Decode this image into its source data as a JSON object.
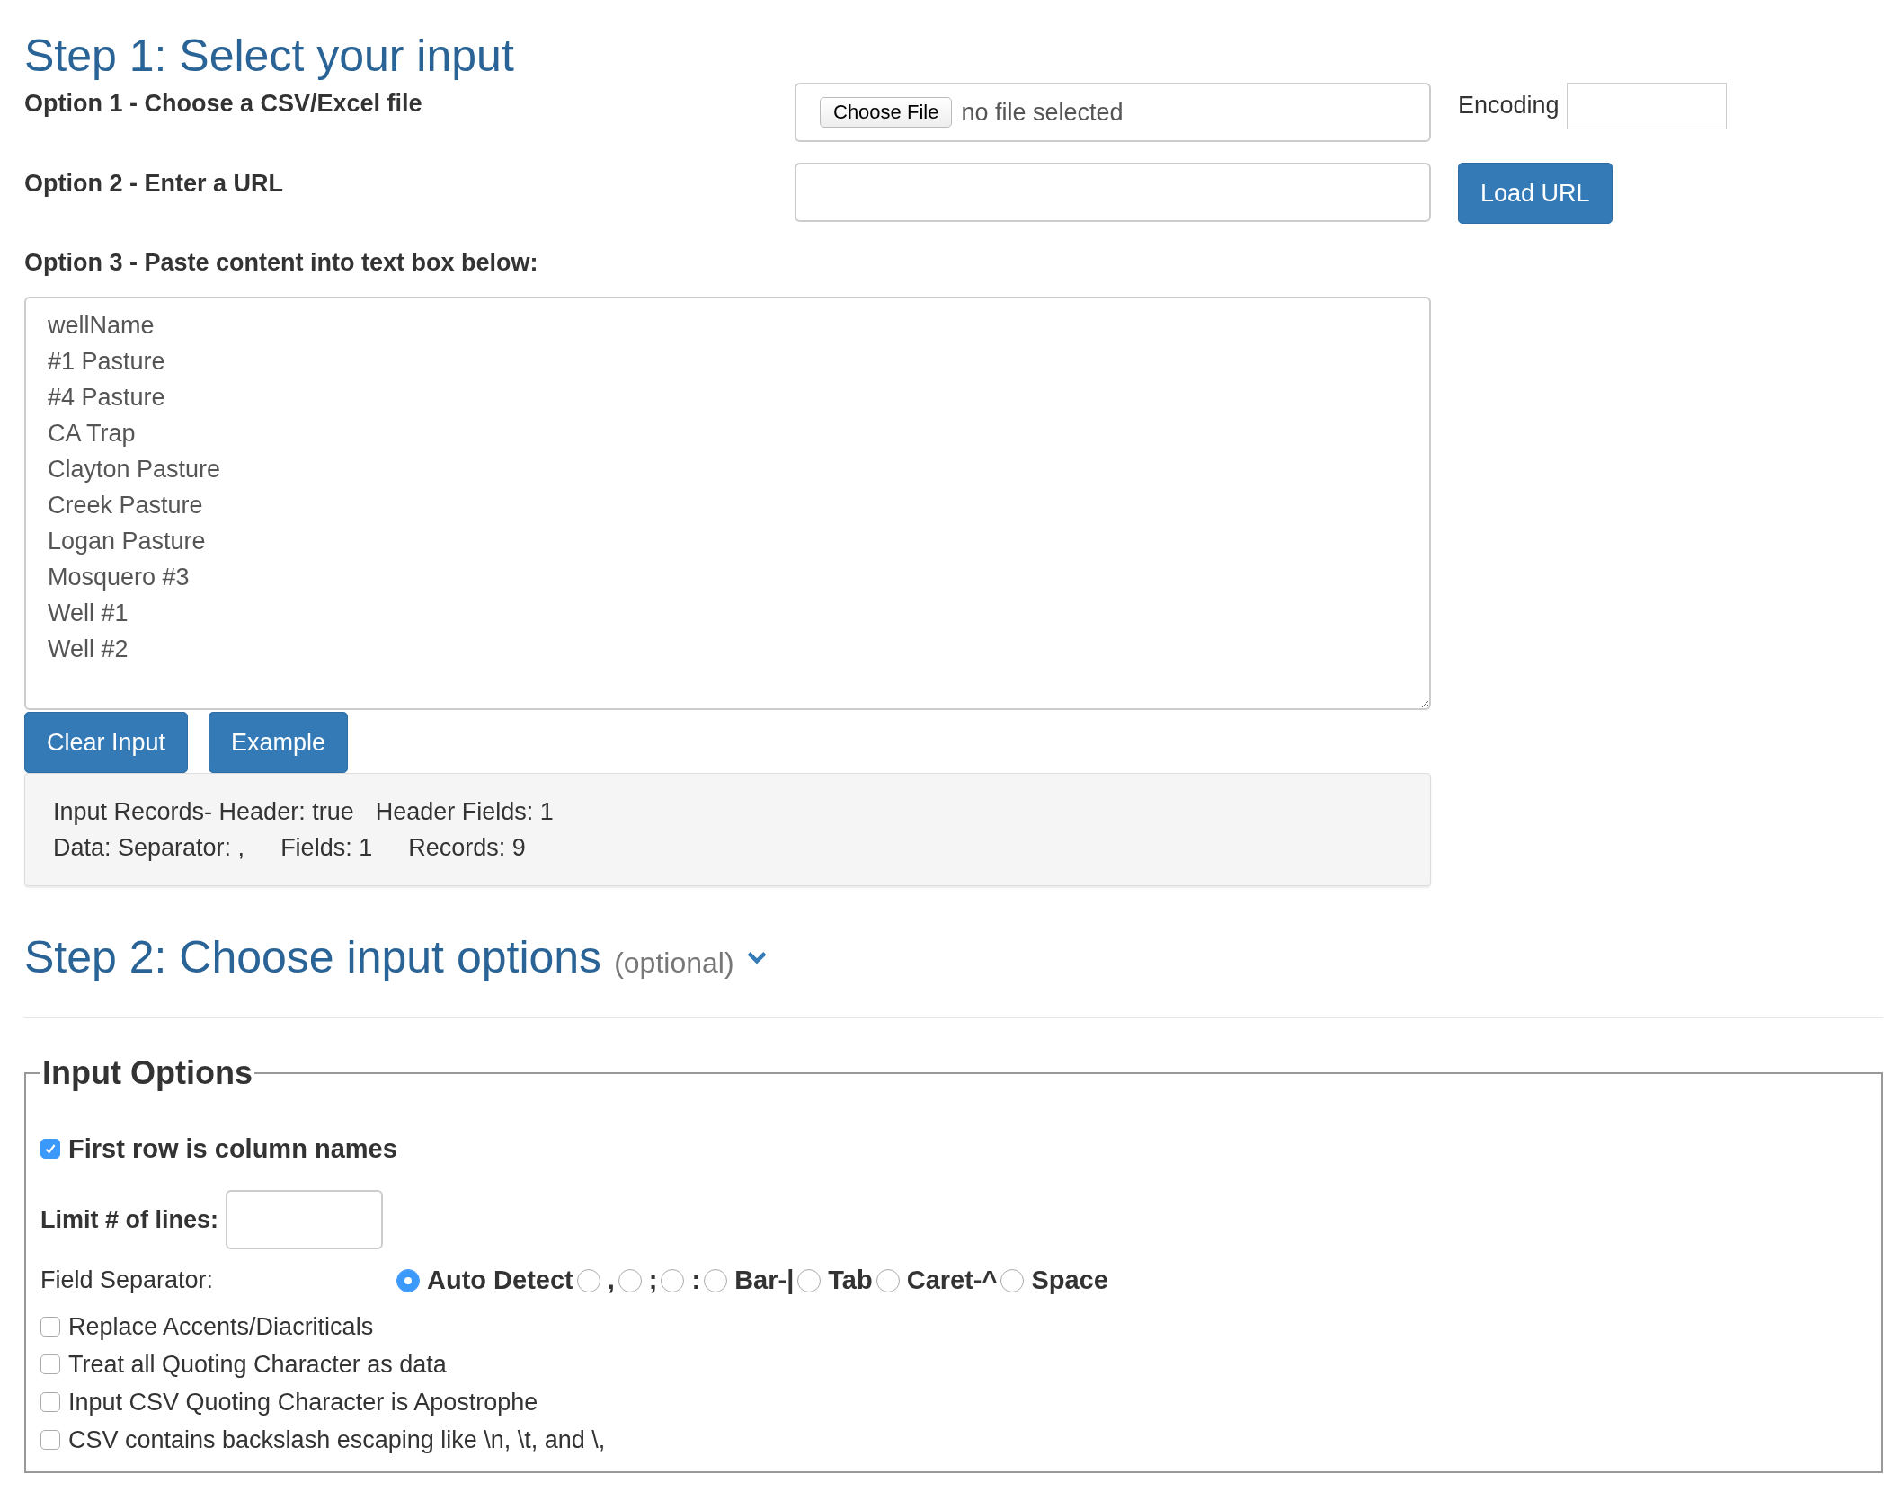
{
  "step1": {
    "title": "Step 1: Select your input",
    "option1": {
      "label": "Option 1 - Choose a CSV/Excel file",
      "file_button": "Choose File",
      "file_status": "no file selected",
      "encoding_label": "Encoding"
    },
    "option2": {
      "label": "Option 2 - Enter a URL",
      "button": "Load URL"
    },
    "option3": {
      "label": "Option 3 - Paste content into text box below:",
      "value": "wellName\n#1 Pasture\n#4 Pasture\nCA Trap\nClayton Pasture\nCreek Pasture\nLogan Pasture\nMosquero #3\nWell #1\nWell #2"
    },
    "buttons": [
      "Clear Input",
      "Example"
    ],
    "stats": [
      [
        "Input Records- Header: true",
        "Header Fields: 1"
      ],
      [
        "Data: Separator: ,",
        "Fields: 1",
        "Records: 9"
      ]
    ]
  },
  "step2": {
    "title": "Step 2: Choose input options",
    "note": "(optional)",
    "expanded": true
  },
  "input_options": {
    "legend": "Input Options",
    "first_row": {
      "label": "First row is column names",
      "checked": true
    },
    "limit_label": "Limit # of lines:",
    "separator_label": "Field Separator:",
    "separators": [
      {
        "label": "Auto Detect",
        "selected": true
      },
      {
        "label": ",",
        "selected": false
      },
      {
        "label": ";",
        "selected": false
      },
      {
        "label": ":",
        "selected": false
      },
      {
        "label": "Bar-|",
        "selected": false
      },
      {
        "label": "Tab",
        "selected": false
      },
      {
        "label": "Caret-^",
        "selected": false
      },
      {
        "label": "Space",
        "selected": false
      }
    ],
    "checkboxes": [
      {
        "label": "Replace Accents/Diacriticals",
        "checked": false
      },
      {
        "label": "Treat all Quoting Character as data",
        "checked": false
      },
      {
        "label": "Input CSV Quoting Character is Apostrophe",
        "checked": false
      },
      {
        "label": "CSV contains backslash escaping like \\n, \\t, and \\,",
        "checked": false
      }
    ]
  }
}
